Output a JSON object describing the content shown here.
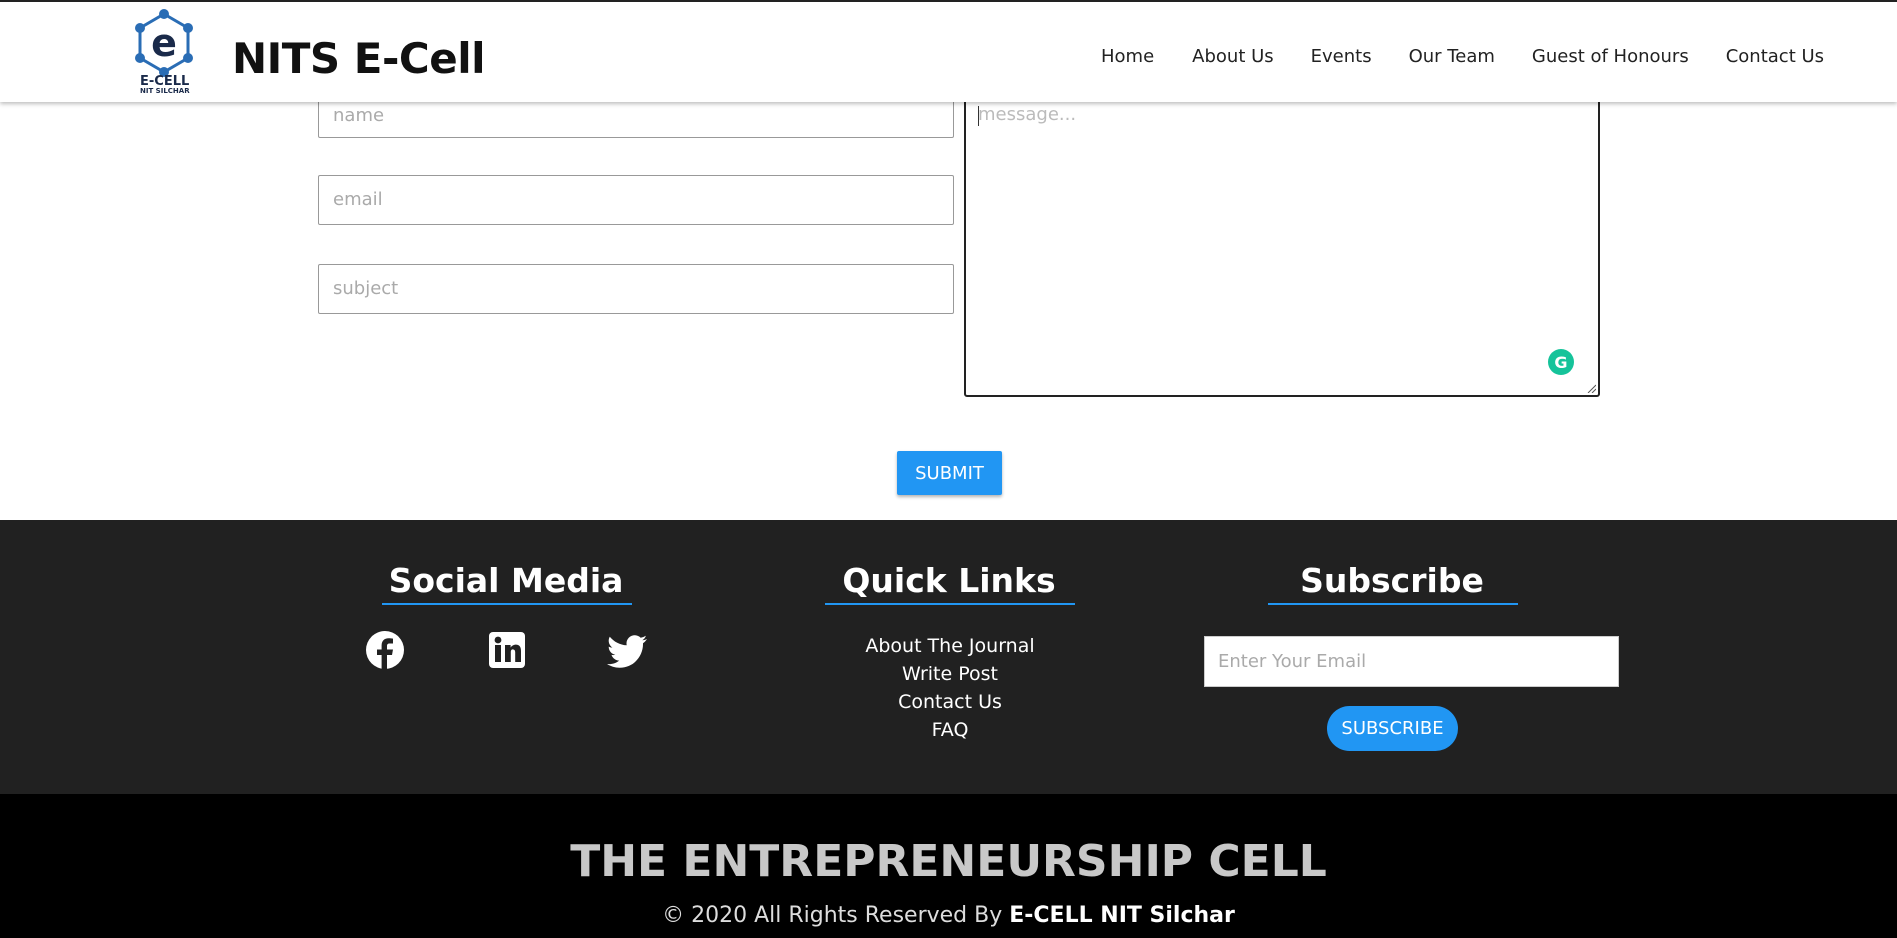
{
  "header": {
    "logo_text": "E-CELL",
    "logo_subtext": "NIT SILCHAR",
    "brand": "NITS E-Cell",
    "nav": [
      "Home",
      "About Us",
      "Events",
      "Our Team",
      "Guest of Honours",
      "Contact Us"
    ]
  },
  "form": {
    "name_placeholder": "name",
    "email_placeholder": "email",
    "subject_placeholder": "subject",
    "message_placeholder": "message...",
    "submit_label": "SUBMIT"
  },
  "footer": {
    "social": {
      "title": "Social Media",
      "icons": [
        "facebook-icon",
        "linkedin-icon",
        "twitter-icon"
      ]
    },
    "quick_links": {
      "title": "Quick Links",
      "items": [
        "About The Journal",
        "Write Post",
        "Contact Us",
        "FAQ"
      ]
    },
    "subscribe": {
      "title": "Subscribe",
      "placeholder": "Enter Your Email",
      "button_label": "SUBSCRIBE"
    }
  },
  "bottom": {
    "title": "THE ENTREPRENEURSHIP CELL",
    "copyright_prefix": "© 2020 All Rights Reserved By ",
    "copyright_owner": "E-CELL NIT Silchar"
  },
  "colors": {
    "accent": "#2196f3",
    "footer_bg": "#212121",
    "bottom_bg": "#000000",
    "grammarly": "#15c39a"
  }
}
